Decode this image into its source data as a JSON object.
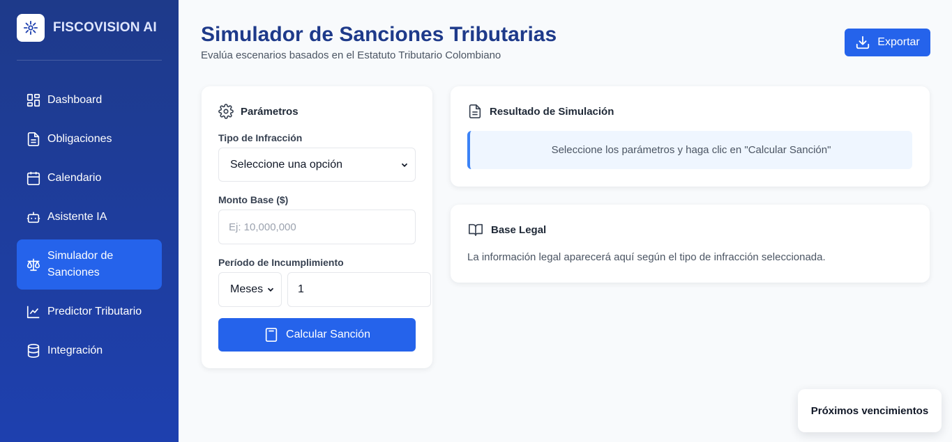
{
  "brand": {
    "name": "FISCOVISION AI"
  },
  "sidebar": {
    "items": [
      {
        "label": "Dashboard",
        "icon": "dashboard-icon"
      },
      {
        "label": "Obligaciones",
        "icon": "document-icon"
      },
      {
        "label": "Calendario",
        "icon": "calendar-icon"
      },
      {
        "label": "Asistente IA",
        "icon": "bot-icon"
      },
      {
        "label_line1": "Simulador de",
        "label_line2": "Sanciones",
        "icon": "scale-icon",
        "active": true
      },
      {
        "label": "Predictor Tributario",
        "icon": "chart-line-icon"
      },
      {
        "label": "Integración",
        "icon": "database-icon"
      }
    ]
  },
  "header": {
    "title": "Simulador de Sanciones Tributarias",
    "subtitle": "Evalúa escenarios basados en el Estatuto Tributario Colombiano",
    "export_label": "Exportar"
  },
  "params": {
    "title": "Parámetros",
    "infraction_label": "Tipo de Infracción",
    "infraction_value": "Seleccione una opción",
    "amount_label": "Monto Base ($)",
    "amount_placeholder": "Ej: 10,000,000",
    "period_label": "Período de Incumplimiento",
    "period_unit": "Meses",
    "period_value": "1",
    "calculate_label": "Calcular Sanción"
  },
  "result": {
    "title": "Resultado de Simulación",
    "message": "Seleccione los parámetros y haga clic en \"Calcular Sanción\""
  },
  "legal": {
    "title": "Base Legal",
    "text": "La información legal aparecerá aquí según el tipo de infracción seleccionada."
  },
  "floating": {
    "label": "Próximos vencimientos"
  },
  "colors": {
    "primary": "#2563eb",
    "sidebar": "#1e40af",
    "title": "#1e3a8a"
  }
}
